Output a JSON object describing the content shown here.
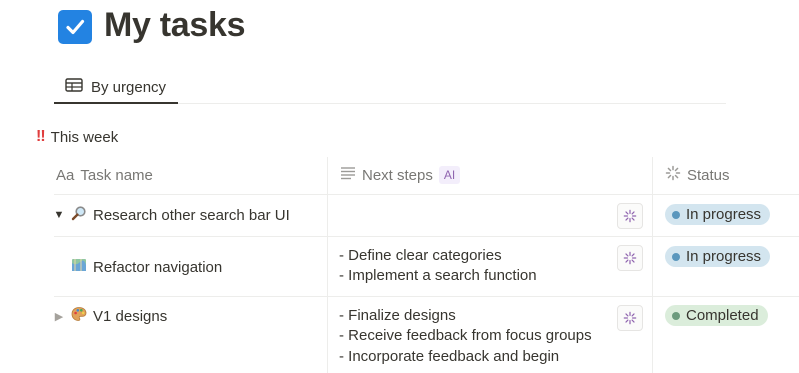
{
  "page": {
    "title": "My tasks"
  },
  "tabs": [
    {
      "label": "By urgency"
    }
  ],
  "group": {
    "marker": "‼",
    "label": "This week"
  },
  "columns": {
    "task_prefix": "Aa",
    "task": "Task name",
    "next_steps": "Next steps",
    "ai_badge": "AI",
    "status": "Status"
  },
  "rows": [
    {
      "name": "Research other search bar UI",
      "icon": "magnifier-icon",
      "expanded": true,
      "steps": [],
      "status": "In progress",
      "status_color": "#d3e5ef"
    },
    {
      "name": "Refactor navigation",
      "icon": "map-icon",
      "expanded": null,
      "steps": [
        "- Define clear categories",
        "- Implement a search function"
      ],
      "status": "In progress",
      "status_color": "#d3e5ef"
    },
    {
      "name": "V1 designs",
      "icon": "palette-icon",
      "expanded": false,
      "steps": [
        "- Finalize designs",
        "- Receive feedback from focus groups",
        "- Incorporate feedback and begin"
      ],
      "status": "Completed",
      "status_color": "#dbeddb"
    }
  ],
  "colors": {
    "accent": "#2383e2",
    "alert": "#e03e3e",
    "ai": "#9065b0"
  }
}
